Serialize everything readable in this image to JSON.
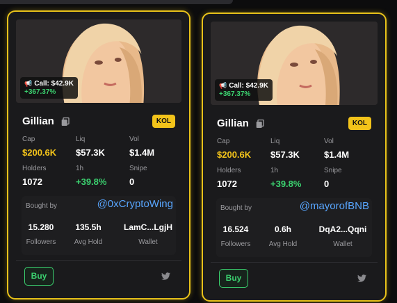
{
  "colors": {
    "accent": "#f2c31a",
    "positive": "#3bd16f",
    "link": "#58a6ff",
    "card_bg": "#1a1a1c",
    "border": "#e8c21a"
  },
  "icons": [
    "megaphone-icon",
    "copy-icon",
    "twitter-icon"
  ],
  "cards": [
    {
      "call_label": "Call: $42.9K",
      "call_change": "+367.37%",
      "name": "Gillian",
      "badge": "KOL",
      "stats": {
        "cap_label": "Cap",
        "cap_value": "$200.6K",
        "liq_label": "Liq",
        "liq_value": "$57.3K",
        "vol_label": "Vol",
        "vol_value": "$1.4M",
        "holders_label": "Holders",
        "holders_value": "1072",
        "h1_label": "1h",
        "h1_value": "+39.8%",
        "snipe_label": "Snipe",
        "snipe_value": "0"
      },
      "bought_by_label": "Bought by",
      "handle": "@0xCryptoWing",
      "followers_value": "15.280",
      "followers_label": "Followers",
      "avg_hold_value": "135.5h",
      "avg_hold_label": "Avg Hold",
      "wallet_value": "LamC...LgjH",
      "wallet_label": "Wallet",
      "buy_label": "Buy"
    },
    {
      "call_label": "Call: $42.9K",
      "call_change": "+367.37%",
      "name": "Gillian",
      "badge": "KOL",
      "stats": {
        "cap_label": "Cap",
        "cap_value": "$200.6K",
        "liq_label": "Liq",
        "liq_value": "$57.3K",
        "vol_label": "Vol",
        "vol_value": "$1.4M",
        "holders_label": "Holders",
        "holders_value": "1072",
        "h1_label": "1h",
        "h1_value": "+39.8%",
        "snipe_label": "Snipe",
        "snipe_value": "0"
      },
      "bought_by_label": "Bought by",
      "handle": "@mayorofBNB",
      "followers_value": "16.524",
      "followers_label": "Followers",
      "avg_hold_value": "0.6h",
      "avg_hold_label": "Avg Hold",
      "wallet_value": "DqA2...Qqni",
      "wallet_label": "Wallet",
      "buy_label": "Buy"
    }
  ]
}
